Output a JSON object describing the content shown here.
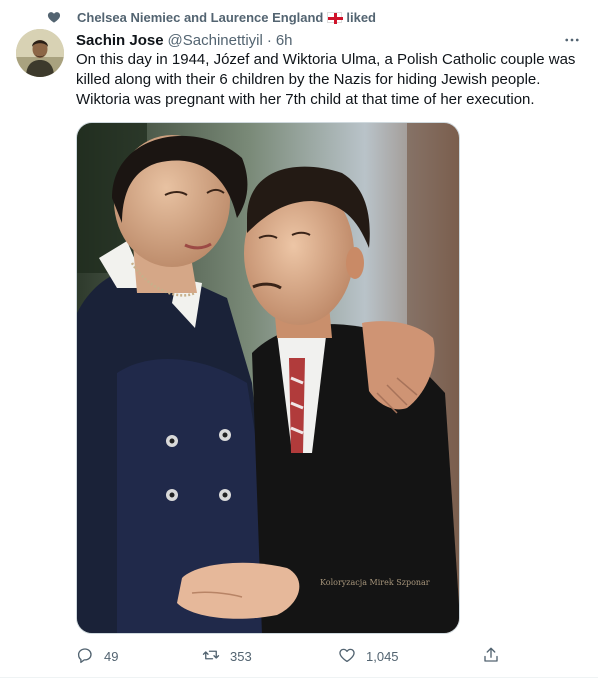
{
  "social_context": {
    "text_before_flag": "Chelsea Niemiec and Laurence England",
    "text_after_flag": "liked",
    "icon": "heart-icon"
  },
  "author": {
    "name": "Sachin Jose",
    "handle": "@Sachinettiyil",
    "separator": "·",
    "time": "6h"
  },
  "tweet": {
    "text": "On this day in 1944, Józef and Wiktoria Ulma, a Polish Catholic couple was killed along with their 6 children by the Nazis for hiding Jewish people. Wiktoria was pregnant with her 7th child at that time of her execution."
  },
  "media": {
    "watermark": "Koloryzacja Mirek Szponar"
  },
  "actions": {
    "replies": "49",
    "retweets": "353",
    "likes": "1,045"
  },
  "colors": {
    "text": "#0f1419",
    "secondary": "#536471",
    "flag_red": "#cf142b"
  }
}
